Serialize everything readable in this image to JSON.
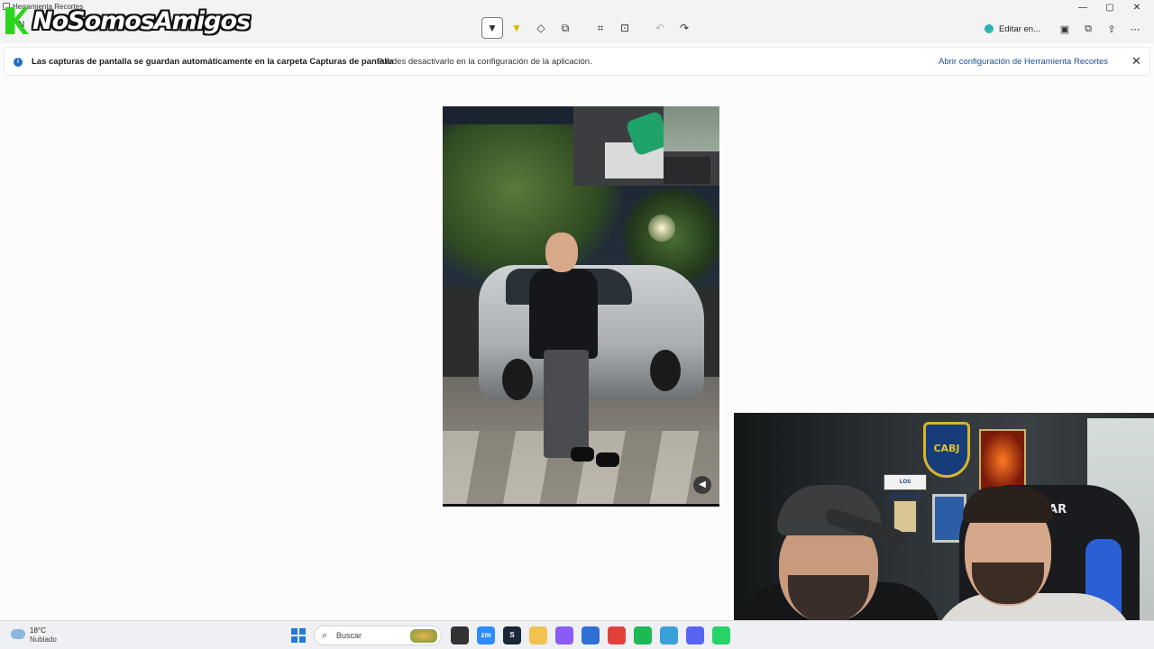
{
  "window": {
    "title": "Herramienta Recortes",
    "new_label": "N"
  },
  "watermark": {
    "text": "NoSomosAmigos"
  },
  "toolbar": {
    "tools": [
      {
        "name": "pen-icon",
        "glyph": "✒"
      },
      {
        "name": "highlighter-icon",
        "glyph": "✎"
      },
      {
        "name": "eraser-icon",
        "glyph": "⌫"
      },
      {
        "name": "shapes-icon",
        "glyph": "◇"
      },
      {
        "name": "crop-icon",
        "glyph": "⌗"
      },
      {
        "name": "text-actions-icon",
        "glyph": "⊡"
      },
      {
        "name": "undo-icon",
        "glyph": "↶"
      },
      {
        "name": "redo-icon",
        "glyph": "↷"
      }
    ],
    "edit_in_label": "Editar en...",
    "right_icons": [
      "save-icon",
      "copy-icon",
      "share-icon",
      "more-icon"
    ]
  },
  "window_controls": {
    "minimize": "—",
    "maximize": "▢",
    "close": "✕"
  },
  "infobar": {
    "message": "Las capturas de pantalla se guardan automáticamente en la carpeta Capturas de pantalla",
    "sub": "Puedes desactivarlo en la configuración de la aplicación.",
    "link": "Abrir configuración de Herramienta Recortes",
    "close": "✕"
  },
  "webcam": {
    "shield_text": "CABJ",
    "chair_text": "ESDAR",
    "plaque_text": "LOS GIRASOLES"
  },
  "taskbar": {
    "weather_temp": "18°C",
    "weather_desc": "Nublado",
    "search_placeholder": "Buscar",
    "apps": [
      {
        "name": "file-icon",
        "label": "",
        "color": "#333333"
      },
      {
        "name": "zoom-icon",
        "label": "zm",
        "color": "#2d8cff"
      },
      {
        "name": "steam-icon",
        "label": "S",
        "color": "#1b2838"
      },
      {
        "name": "folder-icon",
        "label": "",
        "color": "#f2c14e"
      },
      {
        "name": "copilot-icon",
        "label": "",
        "color": "#8a5cf6"
      },
      {
        "name": "store-icon",
        "label": "",
        "color": "#2f6fd6"
      },
      {
        "name": "chrome-icon",
        "label": "",
        "color": "#e0423a"
      },
      {
        "name": "spotify-icon",
        "label": "",
        "color": "#1db954"
      },
      {
        "name": "photos-icon",
        "label": "",
        "color": "#3aa0d8"
      },
      {
        "name": "discord-icon",
        "label": "",
        "color": "#5865f2"
      },
      {
        "name": "whatsapp-icon",
        "label": "",
        "color": "#25d366"
      }
    ]
  }
}
